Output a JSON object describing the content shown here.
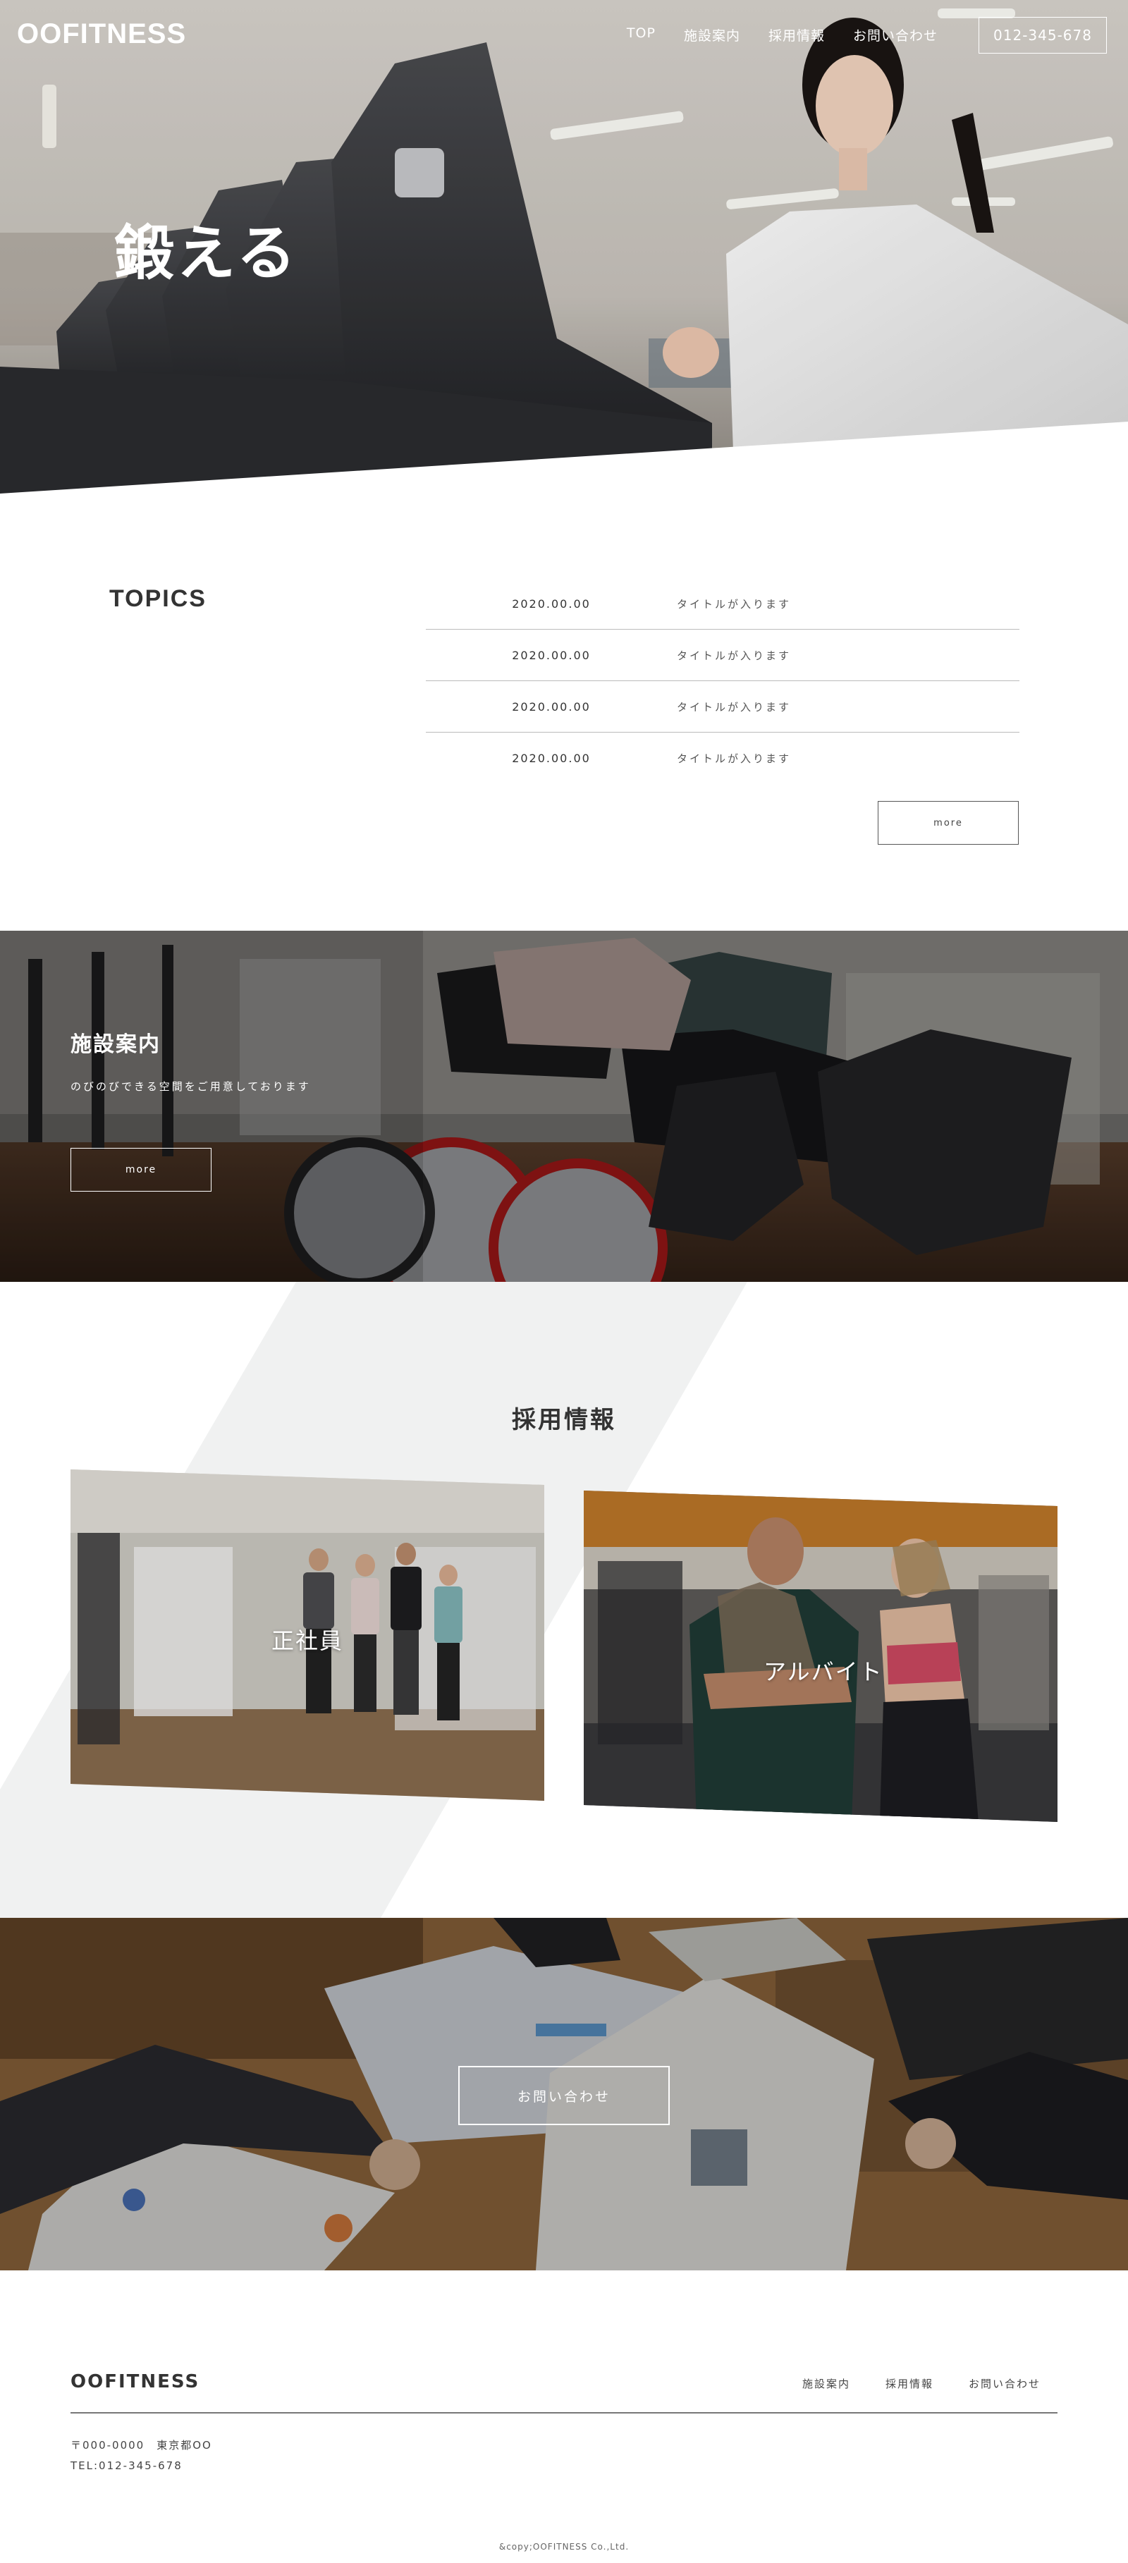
{
  "header": {
    "logo": "OOFITNESS",
    "nav": [
      "TOP",
      "施設案内",
      "採用情報",
      "お問い合わせ"
    ],
    "phone": "012-345-678"
  },
  "hero": {
    "title": "鍛える"
  },
  "topics": {
    "heading": "TOPICS",
    "items": [
      {
        "date": "2020.00.00",
        "title": "タイトルが入ります"
      },
      {
        "date": "2020.00.00",
        "title": "タイトルが入ります"
      },
      {
        "date": "2020.00.00",
        "title": "タイトルが入ります"
      },
      {
        "date": "2020.00.00",
        "title": "タイトルが入ります"
      }
    ],
    "more_label": "more"
  },
  "facility": {
    "title": "施設案内",
    "description": "のびのびできる空間をご用意しております",
    "more_label": "more"
  },
  "recruit": {
    "title": "採用情報",
    "cards": [
      {
        "label": "正社員"
      },
      {
        "label": "アルバイト"
      }
    ]
  },
  "contact": {
    "button_label": "お問い合わせ"
  },
  "footer": {
    "logo": "OOFITNESS",
    "nav": [
      "施設案内",
      "採用情報",
      "お問い合わせ"
    ],
    "address": "〒000-0000　東京都OO",
    "tel": "TEL:012-345-678",
    "copyright": "&copy;OOFITNESS Co.,Ltd."
  },
  "colors": {
    "stripe": "#f0f1f1",
    "rule": "#bbbbbb",
    "text": "#333333"
  }
}
